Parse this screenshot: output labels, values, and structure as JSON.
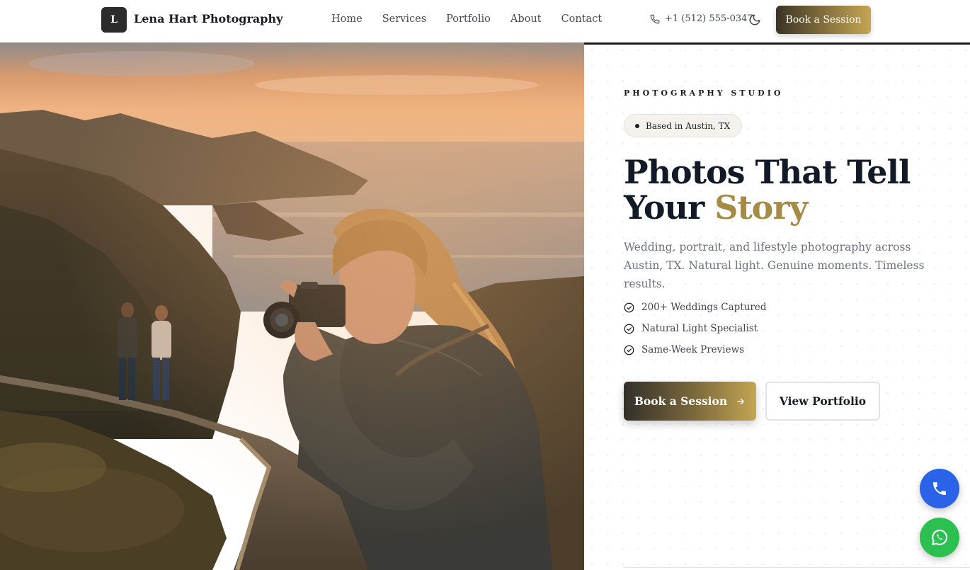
{
  "nav": {
    "logo_letter": "L",
    "brand": "Lena Hart Photography",
    "links": [
      "Home",
      "Services",
      "Portfolio",
      "About",
      "Contact"
    ],
    "phone": "+1 (512) 555-0347",
    "phone_icon": "phone-icon",
    "theme_icon": "moon-icon",
    "cta": "Book a Session"
  },
  "hero": {
    "image_icon": "photographer-photo",
    "eyebrow": "PHOTOGRAPHY STUDIO",
    "location": "Based in Austin, TX",
    "headline_line1": "Photos That Tell",
    "headline_line2_plain": "Your",
    "headline_line2_accent": "Story",
    "lead": "Wedding, portrait, and lifestyle photography across Austin, TX. Natural light. Genuine moments. Timeless results.",
    "features": [
      "200+ Weddings Captured",
      "Natural Light Specialist",
      "Same-Week Previews"
    ],
    "primary_cta": "Book a Session",
    "secondary_cta": "View Portfolio"
  },
  "floating": {
    "call_icon": "phone-icon",
    "whatsapp_icon": "whatsapp-icon"
  },
  "colors": {
    "accent_gold": "#a68b44",
    "call_blue": "#2a62e8",
    "whatsapp_green": "#2bc04f"
  }
}
